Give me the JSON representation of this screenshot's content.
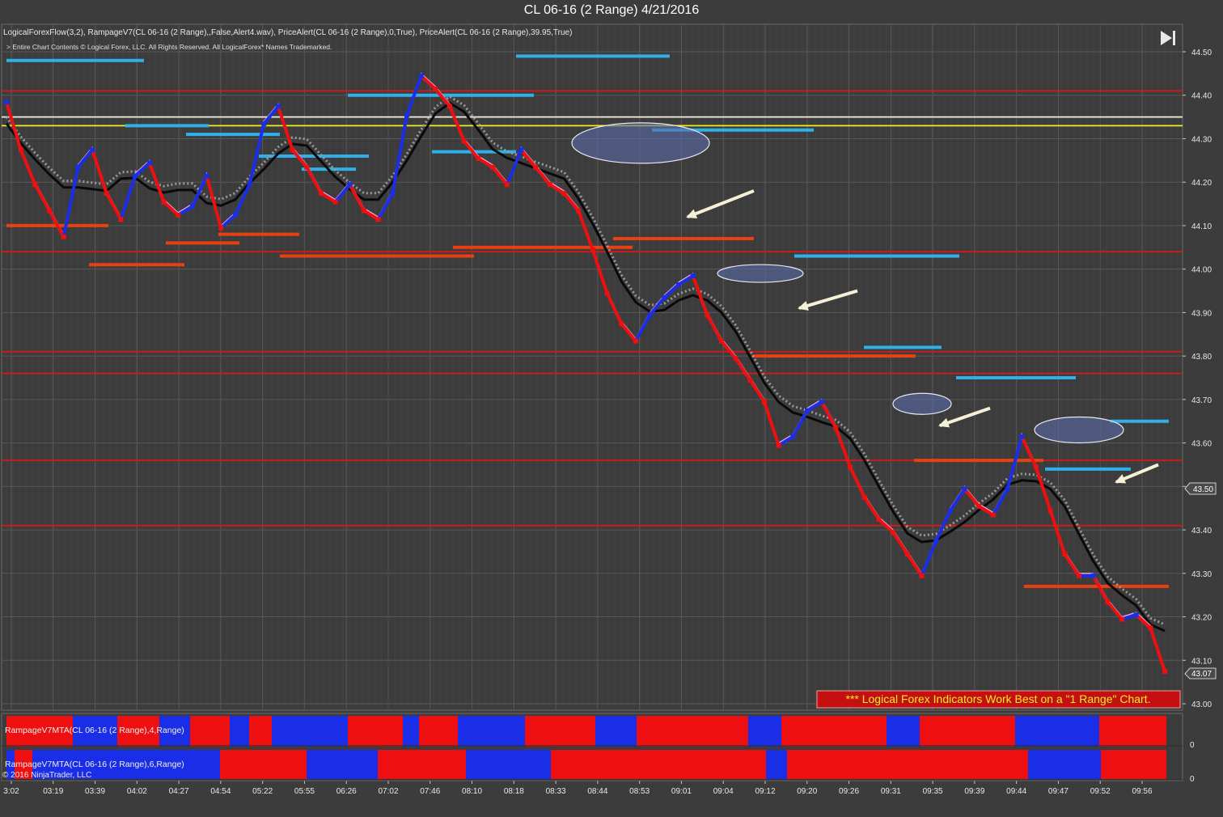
{
  "window": {
    "title": "CL 06-16 (2 Range)  4/21/2016"
  },
  "header": {
    "indicators": "LogicalForexFlow(3,2),  RampageV7(CL 06-16 (2 Range),,False,Alert4.wav), PriceAlert(CL 06-16 (2 Range),0,True), PriceAlert(CL 06-16 (2 Range),39.95,True)",
    "copyright": "> Entire Chart Contents © Logical Forex, LLC. All Rights Reserved. All LogicalForex* Names Trademarked."
  },
  "toolbar": {
    "icon": "skip-to-end-icon"
  },
  "banner": {
    "text": "*** Logical Forex Indicators Work Best on a \"1 Range\" Chart."
  },
  "panels": {
    "mta1": {
      "label": "RampageV7MTA(CL 06-16 (2 Range),4,Range)",
      "zero": "0"
    },
    "mta2": {
      "label": "RampageV7MTA(CL 06-16 (2 Range),6,Range)",
      "zero": "0"
    }
  },
  "footer": {
    "copyright": "© 2016 NinjaTrader, LLC"
  },
  "colors": {
    "background": "#3c3c3c",
    "grid": "#5a5a5a",
    "up": "#1a2ee8",
    "down": "#ee1010",
    "support": "#d81818",
    "highlight_yellow": "#f0ee20",
    "highlight_white": "#f4f0e0",
    "arrow": "#f7f0d8",
    "price_trace": "#f2a8f0",
    "ellipse": "#5a6aa8"
  },
  "chart_data": {
    "type": "line",
    "title": "CL 06-16 (2 Range)  4/21/2016",
    "ylim": [
      43.0,
      44.5
    ],
    "y_ticks": [
      "43.00",
      "43.10",
      "43.20",
      "43.30",
      "43.40",
      "43.50",
      "43.60",
      "43.70",
      "43.80",
      "43.90",
      "44.00",
      "44.10",
      "44.20",
      "44.30",
      "44.40",
      "44.50"
    ],
    "x_ticks": [
      "3:02",
      "03:19",
      "03:39",
      "04:02",
      "04:27",
      "04:54",
      "05:22",
      "05:55",
      "06:26",
      "07:02",
      "07:46",
      "08:10",
      "08:18",
      "08:33",
      "08:44",
      "08:53",
      "09:01",
      "09:04",
      "09:12",
      "09:20",
      "09:26",
      "09:31",
      "09:35",
      "09:39",
      "09:44",
      "09:47",
      "09:52",
      "09:56"
    ],
    "last_price": "43.07",
    "marker_price": "43.50",
    "horizontal_levels": [
      {
        "price": 44.41,
        "color": "red"
      },
      {
        "price": 44.35,
        "color": "white"
      },
      {
        "price": 44.33,
        "color": "yellow"
      },
      {
        "price": 44.04,
        "color": "red"
      },
      {
        "price": 43.81,
        "color": "red"
      },
      {
        "price": 43.76,
        "color": "red"
      },
      {
        "price": 43.56,
        "color": "red"
      },
      {
        "price": 43.41,
        "color": "red"
      }
    ],
    "series": [
      {
        "values": [
          44.39,
          44.28,
          44.2,
          44.14,
          44.08,
          44.24,
          44.28,
          44.18,
          44.12,
          44.22,
          44.25,
          44.16,
          44.13,
          44.15,
          44.22,
          44.1,
          44.13,
          44.2,
          44.34,
          44.38,
          44.28,
          44.24,
          44.18,
          44.16,
          44.2,
          44.14,
          44.12,
          44.18,
          44.36,
          44.45,
          44.42,
          44.38,
          44.3,
          44.26,
          44.24,
          44.2,
          44.28,
          44.24,
          44.2,
          44.18,
          44.14,
          44.05,
          43.95,
          43.88,
          43.84,
          43.9,
          43.94,
          43.97,
          43.99,
          43.9,
          43.84,
          43.8,
          43.75,
          43.7,
          43.6,
          43.62,
          43.68,
          43.7,
          43.64,
          43.55,
          43.48,
          43.43,
          43.4,
          43.35,
          43.3,
          43.38,
          43.45,
          43.5,
          43.46,
          43.44,
          43.5,
          43.62,
          43.55,
          43.45,
          43.35,
          43.3,
          43.3,
          43.24,
          43.2,
          43.21,
          43.18,
          43.08
        ]
      }
    ]
  }
}
